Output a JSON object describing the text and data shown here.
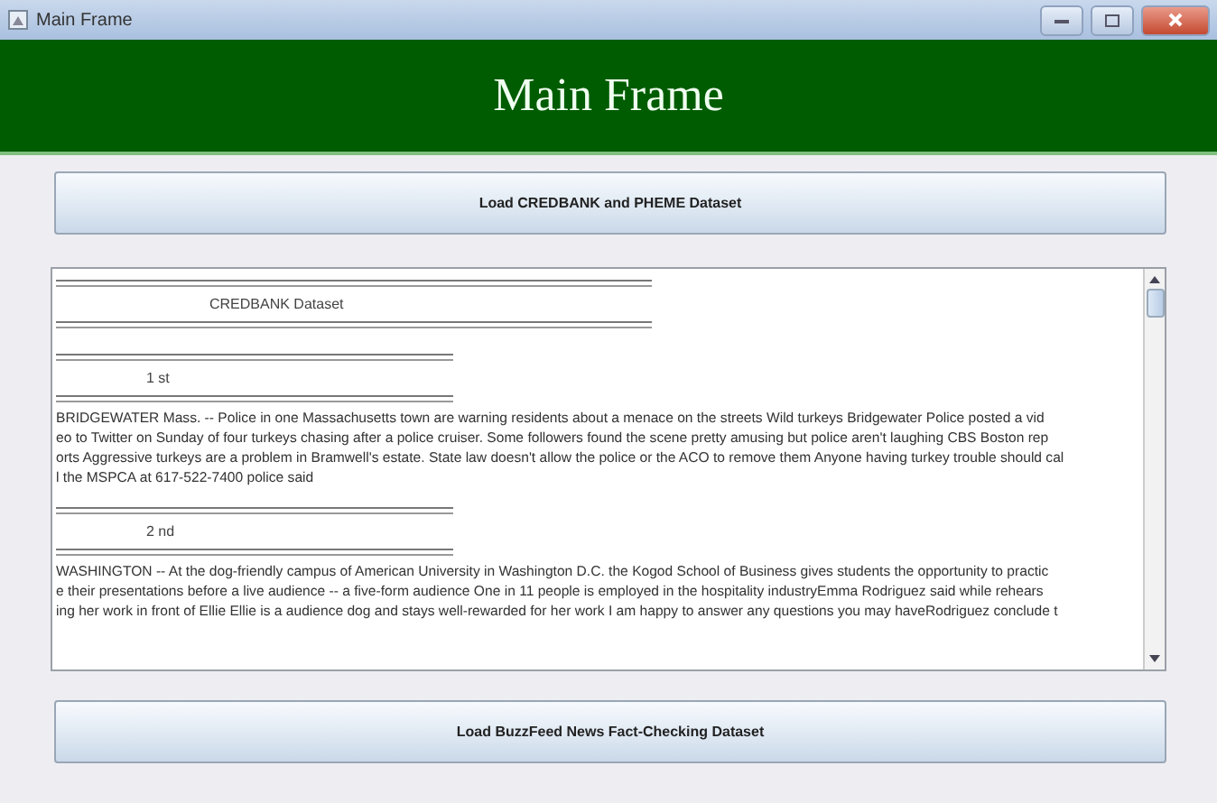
{
  "window": {
    "title": "Main Frame"
  },
  "banner": {
    "title": "Main Frame"
  },
  "load_button_top": {
    "label": "Load CREDBANK and PHEME Dataset"
  },
  "text_area": {
    "dataset_heading": "CREDBANK Dataset",
    "records": [
      {
        "number": "1 st",
        "lines": [
          "BRIDGEWATER Mass. -- Police in one Massachusetts town are warning residents about a menace on the streets Wild turkeys Bridgewater Police posted a vid",
          "eo to Twitter on Sunday of four turkeys chasing after a police cruiser. Some followers found the scene pretty amusing but police aren't laughing CBS Boston rep",
          "orts Aggressive turkeys are a problem in Bramwell's estate. State law doesn't allow the police or the ACO to remove them Anyone having turkey trouble should cal",
          "l the MSPCA at 617-522-7400 police said"
        ]
      },
      {
        "number": "2 nd",
        "lines": [
          "WASHINGTON -- At the dog-friendly campus of American University in Washington D.C. the Kogod School of Business gives students the opportunity to practic",
          "e their presentations before a live audience -- a five-form audience One in 11 people is employed in the hospitality industryEmma Rodriguez said while rehears",
          "ing her work in front of Ellie Ellie is a audience dog and stays well-rewarded for her work I am happy to answer any questions you may haveRodriguez conclude t"
        ]
      }
    ]
  },
  "load_button_bottom": {
    "label": "Load BuzzFeed News Fact-Checking Dataset"
  }
}
